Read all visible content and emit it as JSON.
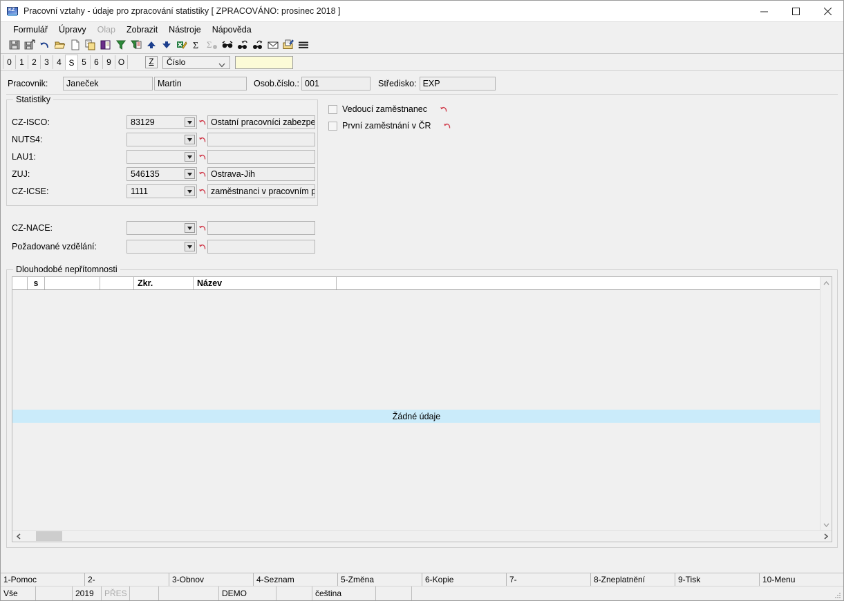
{
  "window": {
    "title": "Pracovní vztahy - údaje pro zpracování statistiky [ ZPRACOVÁNO: prosinec 2018 ]",
    "app_icon": "application-icon",
    "minimize_label": "minimize-icon",
    "maximize_label": "maximize-icon",
    "close_label": "close-icon"
  },
  "menu": {
    "items": [
      {
        "label": "Formulář",
        "disabled": false
      },
      {
        "label": "Úpravy",
        "disabled": false
      },
      {
        "label": "Olap",
        "disabled": true
      },
      {
        "label": "Zobrazit",
        "disabled": false
      },
      {
        "label": "Nástroje",
        "disabled": false
      },
      {
        "label": "Nápověda",
        "disabled": false
      }
    ]
  },
  "toolbar": {
    "buttons": [
      {
        "name": "save-icon",
        "tip": "Uložit"
      },
      {
        "name": "save-exit-icon",
        "tip": "Uložit a zavřít"
      },
      {
        "name": "undo-icon",
        "tip": "Zpět"
      },
      {
        "name": "open-folder-icon",
        "tip": "Otevřít"
      },
      {
        "name": "new-document-icon",
        "tip": "Nový"
      },
      {
        "name": "copy-icon",
        "tip": "Kopírovat"
      },
      {
        "name": "book-icon",
        "tip": "Číselník"
      },
      {
        "name": "filter-icon",
        "tip": "Filtr"
      },
      {
        "name": "filter-clear-icon",
        "tip": "Zrušit filtr"
      },
      {
        "name": "arrow-up-icon",
        "tip": "Předchozí"
      },
      {
        "name": "arrow-down-icon",
        "tip": "Další"
      },
      {
        "name": "export-excel-icon",
        "tip": "Export do Excelu"
      },
      {
        "name": "sum-icon",
        "tip": "Součet"
      },
      {
        "name": "sum-clear-icon",
        "tip": "Zrušit součet"
      },
      {
        "name": "find-icon",
        "tip": "Hledat"
      },
      {
        "name": "find-prev-icon",
        "tip": "Hledat předchozí"
      },
      {
        "name": "find-next-icon",
        "tip": "Hledat další"
      },
      {
        "name": "mail-icon",
        "tip": "Odeslat e-mailem"
      },
      {
        "name": "edit-note-icon",
        "tip": "Poznámka"
      },
      {
        "name": "menu-lines-icon",
        "tip": "Menu"
      }
    ]
  },
  "tabstrip": {
    "tabs": [
      "0",
      "1",
      "2",
      "3",
      "4",
      "S",
      "5",
      "6",
      "9",
      "O"
    ],
    "active_tab": "S",
    "z_button": "Z",
    "search_mode": "Číslo",
    "search_value": ""
  },
  "person": {
    "pracovnik_label": "Pracovnik:",
    "surname": "Janeček",
    "firstname": "Martin",
    "osob_cislo_label": "Osob.číslo.:",
    "osob_cislo": "001",
    "stredisko_label": "Středisko:",
    "stredisko": "EXP"
  },
  "statistiky": {
    "title": "Statistiky",
    "rows": [
      {
        "label": "CZ-ISCO:",
        "code": "83129",
        "desc": "Ostatní pracovníci zabezpečují"
      },
      {
        "label": "NUTS4:",
        "code": "",
        "desc": ""
      },
      {
        "label": "LAU1:",
        "code": "",
        "desc": ""
      },
      {
        "label": "ZUJ:",
        "code": "546135",
        "desc": "Ostrava-Jih"
      },
      {
        "label": "CZ-ICSE:",
        "code": "1111",
        "desc": "zaměstnanci v pracovním poměr"
      }
    ],
    "checkboxes": [
      {
        "label": "Vedoucí zaměstnanec",
        "checked": false
      },
      {
        "label": "První zaměstnání v ČR",
        "checked": false
      }
    ]
  },
  "extra_fields": {
    "rows": [
      {
        "label": "CZ-NACE:",
        "code": "",
        "desc": ""
      },
      {
        "label": "Požadované vzdělání:",
        "code": "",
        "desc": ""
      }
    ]
  },
  "absences": {
    "title": "Dlouhodobé nepřítomnosti",
    "columns": [
      "",
      "s",
      "",
      "",
      "Zkr.",
      "Název",
      ""
    ],
    "rows": [],
    "empty_message": "Žádné údaje"
  },
  "function_keys": [
    "1-Pomoc",
    "2-",
    "3-Obnov",
    "4-Seznam",
    "5-Změna",
    "6-Kopie",
    "7-",
    "8-Zneplatnění",
    "9-Tisk",
    "10-Menu"
  ],
  "statusbar": {
    "cells": [
      {
        "text": "Vše",
        "dim": false
      },
      {
        "text": "",
        "dim": false
      },
      {
        "text": "2019",
        "dim": false
      },
      {
        "text": "PŘES",
        "dim": true
      },
      {
        "text": "",
        "dim": false
      },
      {
        "text": "",
        "dim": false
      },
      {
        "text": "DEMO",
        "dim": false
      },
      {
        "text": "",
        "dim": false
      },
      {
        "text": "čeština",
        "dim": false
      },
      {
        "text": "",
        "dim": false
      },
      {
        "text": "",
        "dim": false
      }
    ]
  },
  "colors": {
    "window_bg": "#f0f0f0",
    "field_bg": "#eeeeee",
    "field_border": "#b4b4b4",
    "selection_blue": "#caebfa",
    "search_yellow": "#fcfbd7",
    "accent_blue": "#1f3a73"
  }
}
